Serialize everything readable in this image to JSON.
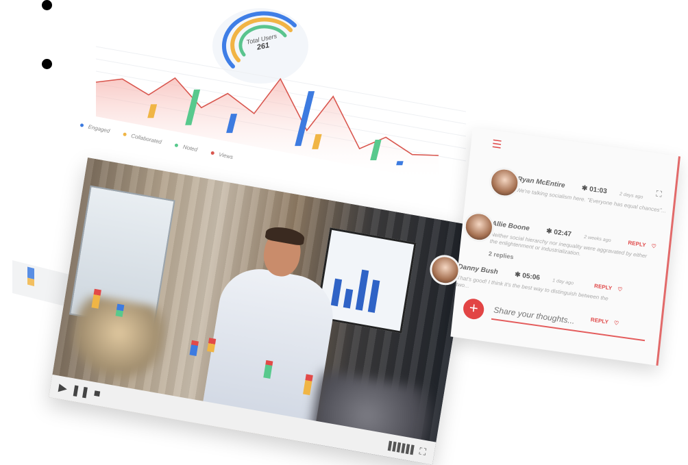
{
  "donut": {
    "title": "Total Users",
    "value": "261"
  },
  "chart_data": {
    "type": "area",
    "legend": [
      "Engaged",
      "Collaborated",
      "Noted",
      "Views"
    ],
    "colors": {
      "Engaged": "#3d7be0",
      "Collaborated": "#f0b545",
      "Noted": "#58c98d",
      "Views": "#d9574f"
    },
    "bars": [
      {
        "series": "Collaborated",
        "value": 20
      },
      {
        "series": "Noted",
        "value": 52
      },
      {
        "series": "Engaged",
        "value": 28
      },
      {
        "series": "Engaged",
        "value": 80
      },
      {
        "series": "Collaborated",
        "value": 22
      },
      {
        "series": "Noted",
        "value": 30
      },
      {
        "series": "Engaged",
        "value": 6
      }
    ],
    "views_curve": [
      40,
      52,
      36,
      68,
      32,
      60,
      38,
      96,
      28,
      85,
      16,
      40,
      22,
      28
    ]
  },
  "video": {
    "controls": {
      "play": "▶",
      "pause": "❚❚",
      "stop": "■",
      "volume": "▌▌▌▌▌▌",
      "fullscreen": "⛶"
    }
  },
  "comments": {
    "items": [
      {
        "name": "Ryan McEntire",
        "time": "01:03",
        "ago": "2 days ago",
        "text": "We're talking socialism here. \"Everyone has equal chances\"...",
        "reply": ""
      },
      {
        "name": "Allie Boone",
        "time": "02:47",
        "ago": "2 weeks ago",
        "text": "Neither social hierarchy nor inequality were aggravated by either the enlightenment or industrialization.",
        "reply": "REPLY"
      },
      {
        "name": "Danny Bush",
        "time": "05:06",
        "ago": "1 day ago",
        "text": "That's good! I think it's the best way to distinguish between the two...",
        "reply": "REPLY"
      }
    ],
    "replies_label": "2 replies",
    "reply_bottom": "REPLY",
    "input_placeholder": "Share your thoughts..."
  }
}
